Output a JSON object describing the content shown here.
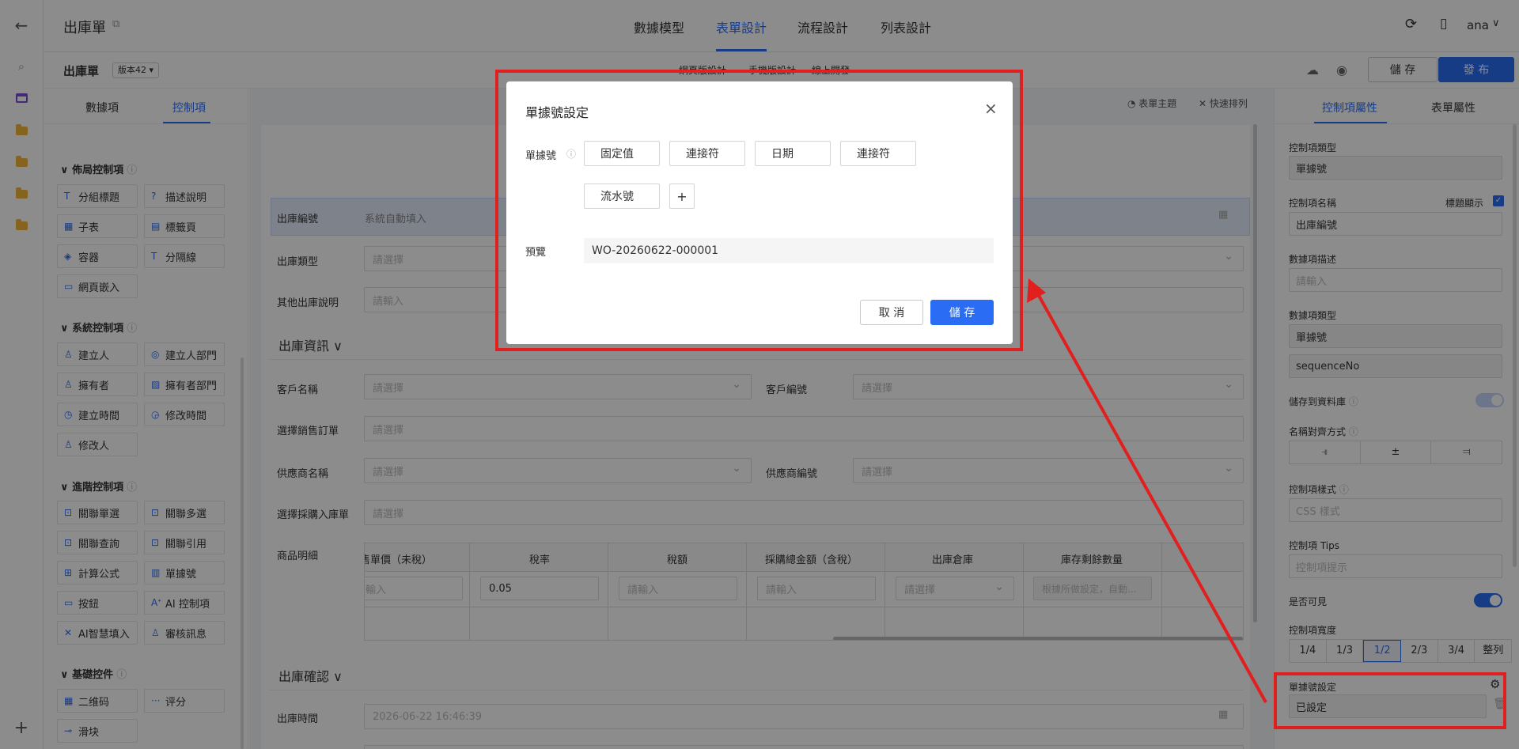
{
  "rail": {
    "icons": [
      "back-arrow-icon",
      "search-icon",
      "table-icon",
      "folder-icon",
      "folder-icon",
      "folder-icon",
      "folder-icon",
      "plus-icon"
    ]
  },
  "header": {
    "title": "出庫單",
    "tabs": [
      "數據模型",
      "表單設計",
      "流程設計",
      "列表設計"
    ],
    "active_tab": "表單設計",
    "user": "ana"
  },
  "subbar": {
    "form_name": "出庫單",
    "version": "版本42",
    "center_tabs": [
      "網頁版設計",
      "手機版設計",
      "線上開發"
    ],
    "save_label": "儲 存",
    "publish_label": "發 布"
  },
  "left_panel": {
    "tabs": [
      "數據項",
      "控制項"
    ],
    "sections": [
      {
        "title": "佈局控制項",
        "items": [
          [
            "T",
            "分組標題"
          ],
          [
            "?",
            "描述說明"
          ],
          [
            "▦",
            "子表"
          ],
          [
            "▤",
            "標籤頁"
          ],
          [
            "◈",
            "容器"
          ],
          [
            "T",
            "分隔線"
          ],
          [
            "▭",
            "網頁嵌入"
          ]
        ]
      },
      {
        "title": "系統控制項",
        "items": [
          [
            "♙",
            "建立人"
          ],
          [
            "◎",
            "建立人部門"
          ],
          [
            "♙",
            "擁有者"
          ],
          [
            "▨",
            "擁有者部門"
          ],
          [
            "◷",
            "建立時間"
          ],
          [
            "◶",
            "修改時間"
          ],
          [
            "♙",
            "修改人"
          ]
        ]
      },
      {
        "title": "進階控制項",
        "items": [
          [
            "⊡",
            "關聯單選"
          ],
          [
            "⊡",
            "關聯多選"
          ],
          [
            "⊡",
            "關聯查詢"
          ],
          [
            "⊡",
            "關聯引用"
          ],
          [
            "⊞",
            "計算公式"
          ],
          [
            "▥",
            "單據號"
          ],
          [
            "▭",
            "按鈕"
          ],
          [
            "Aᐩ",
            "AI 控制項"
          ],
          [
            "✕",
            "AI智慧填入"
          ],
          [
            "♙",
            "審核訊息"
          ]
        ]
      },
      {
        "title": "基礎控件",
        "items": [
          [
            "▦",
            "二维码"
          ],
          [
            "···",
            "评分"
          ],
          [
            "⊸",
            "滑块"
          ]
        ]
      }
    ]
  },
  "canvas": {
    "toolbar": [
      "表單主題",
      "快速排列"
    ],
    "fields": {
      "outbound_no": {
        "label": "出庫編號",
        "value": "系統自動填入"
      },
      "outbound_type": {
        "label": "出庫類型",
        "placeholder": "請選擇"
      },
      "other_desc": {
        "label": "其他出庫說明",
        "placeholder": "請輸入"
      },
      "group1": "出庫資訊",
      "customer_name": {
        "label": "客戶名稱",
        "placeholder": "請選擇"
      },
      "customer_no": {
        "label": "客戶編號",
        "placeholder": "請選擇"
      },
      "sales_order": {
        "label": "選擇銷售訂單",
        "placeholder": "請選擇"
      },
      "supplier_name": {
        "label": "供應商名稱",
        "placeholder": "請選擇"
      },
      "supplier_no": {
        "label": "供應商編號",
        "placeholder": "請選擇"
      },
      "purchase_in": {
        "label": "選擇採購入庫單",
        "placeholder": "請選擇"
      },
      "items_label": "商品明細",
      "table_headers": [
        "售單價（未稅）",
        "稅率",
        "稅額",
        "採購總金額（含稅）",
        "出庫倉庫",
        "庫存剩餘數量"
      ],
      "table_row": [
        "輸入",
        "0.05",
        "請輸入",
        "請輸入",
        "請選擇",
        "根據所做設定，自動..."
      ],
      "group2": "出庫確認",
      "out_time": {
        "label": "出庫時間",
        "value": "2026-06-22 16:46:39"
      }
    }
  },
  "right_panel": {
    "tabs": [
      "控制項屬性",
      "表單屬性"
    ],
    "control_type_label": "控制項類型",
    "control_type": "單據號",
    "control_name_label": "控制項名稱",
    "show_title_label": "標題顯示",
    "control_name": "出庫編號",
    "desc_label": "數據項描述",
    "desc_placeholder": "請輸入",
    "data_type_label": "數據項類型",
    "data_type": "單據號",
    "data_key": "sequenceNo",
    "save_db_label": "儲存到資料庫",
    "align_label": "名稱對齊方式",
    "style_label": "控制項樣式",
    "style_placeholder": "CSS 樣式",
    "tips_label": "控制項 Tips",
    "tips_placeholder": "控制項提示",
    "visible_label": "是否可見",
    "width_label": "控制項寬度",
    "widths": [
      "1/4",
      "1/3",
      "1/2",
      "2/3",
      "3/4",
      "整列"
    ],
    "active_width": "1/2",
    "seq_label": "單據號設定",
    "seq_value": "已設定"
  },
  "modal": {
    "title": "單據號設定",
    "seq_label": "單據號",
    "segments": [
      "固定值",
      "連接符",
      "日期",
      "連接符",
      "流水號"
    ],
    "add": "+",
    "preview_label": "預覽",
    "preview_value": "WO-20260622-000001",
    "cancel": "取 消",
    "save": "儲 存"
  },
  "colors": {
    "accent": "#2a6df4",
    "annotation": "#e21f1f"
  }
}
